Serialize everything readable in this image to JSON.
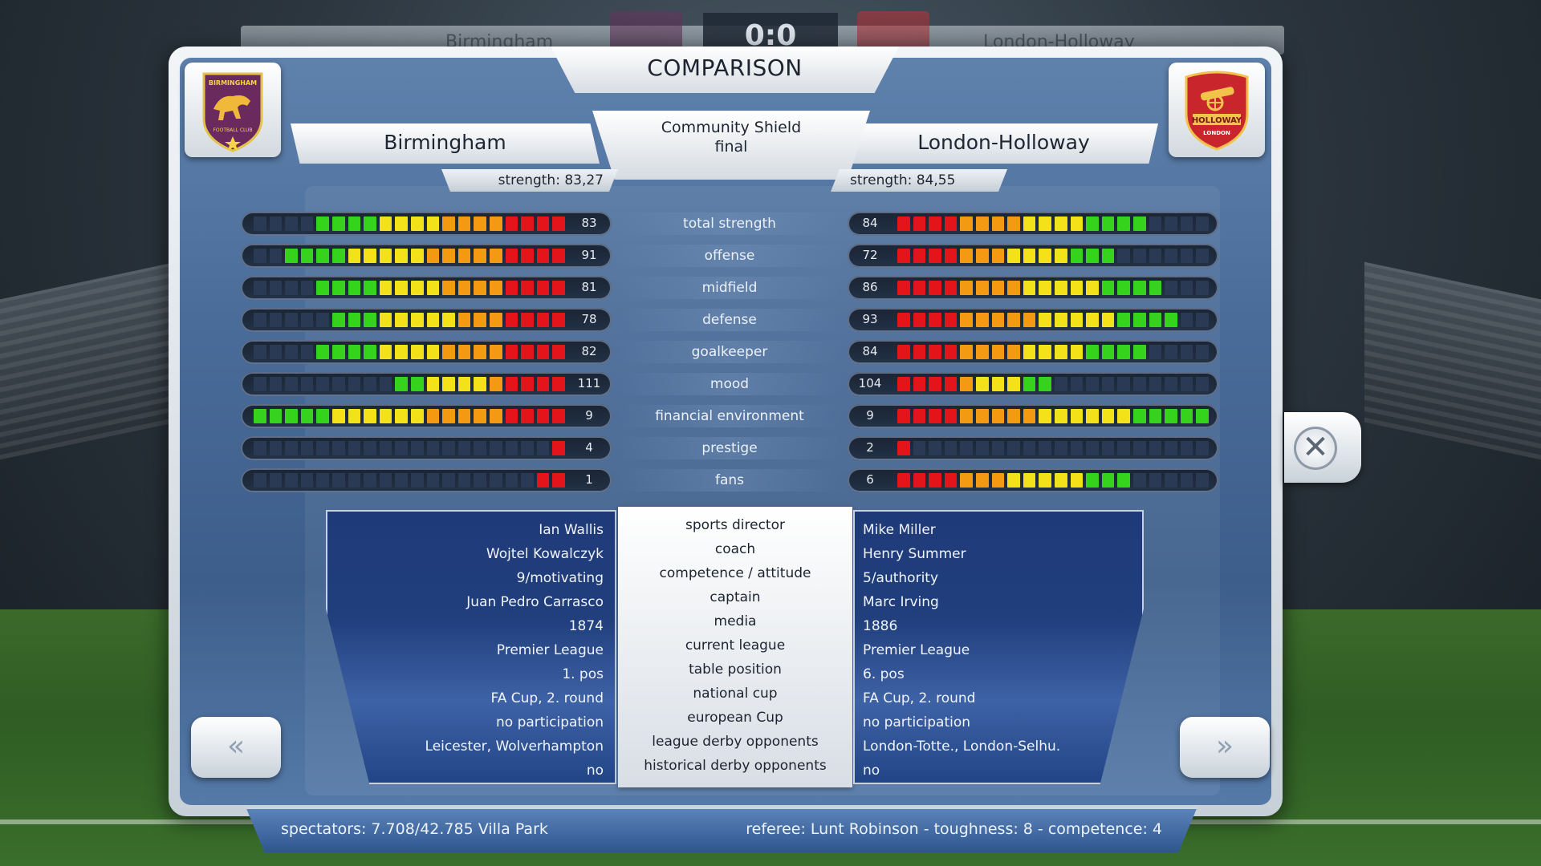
{
  "screen_title": "COMPARISON",
  "top_header": {
    "score": "0:0",
    "home_name": "Birmingham",
    "away_name": "London-Holloway"
  },
  "home_team": {
    "name": "Birmingham",
    "strength_text": "strength: 83,27",
    "crest_text_top": "BIRMINGHAM",
    "crest_text_bottom": "FOOTBALL CLUB",
    "crest_color": "#6b2a5e",
    "crest_icon": "dog-icon"
  },
  "away_team": {
    "name": "London-Holloway",
    "strength_text": "strength: 84,55",
    "crest_text_top": "HOLLOWAY",
    "crest_text_bottom": "LONDON",
    "crest_color": "#c8262c",
    "crest_icon": "cannon-icon"
  },
  "event": {
    "line1": "Community Shield",
    "line2": "final"
  },
  "stats": [
    {
      "label": "total strength",
      "home_value": "83",
      "away_value": "84",
      "home_fill": 16,
      "away_fill": 16
    },
    {
      "label": "offense",
      "home_value": "91",
      "away_value": "72",
      "home_fill": 18,
      "away_fill": 14
    },
    {
      "label": "midfield",
      "home_value": "81",
      "away_value": "86",
      "home_fill": 16,
      "away_fill": 17
    },
    {
      "label": "defense",
      "home_value": "78",
      "away_value": "93",
      "home_fill": 15,
      "away_fill": 18
    },
    {
      "label": "goalkeeper",
      "home_value": "82",
      "away_value": "84",
      "home_fill": 16,
      "away_fill": 16
    },
    {
      "label": "mood",
      "home_value": "111",
      "away_value": "104",
      "home_fill": 11,
      "away_fill": 10
    },
    {
      "label": "financial environment",
      "home_value": "9",
      "away_value": "9",
      "home_fill": 20,
      "away_fill": 20
    },
    {
      "label": "prestige",
      "home_value": "4",
      "away_value": "2",
      "home_fill": 1,
      "away_fill": 1
    },
    {
      "label": "fans",
      "home_value": "1",
      "away_value": "6",
      "home_fill": 2,
      "away_fill": 15
    }
  ],
  "bar_segments_total": 20,
  "bar_colors": {
    "red": "#e3151a",
    "orange": "#f39a12",
    "yellow": "#f3e21a",
    "green": "#35d31c",
    "empty": "#2a3a55"
  },
  "info_rows": [
    {
      "label": "sports director",
      "home": "Ian Wallis",
      "away": "Mike Miller"
    },
    {
      "label": "coach",
      "home": "Wojtel Kowalczyk",
      "away": "Henry Summer"
    },
    {
      "label": "competence / attitude",
      "home": "9/motivating",
      "away": "5/authority"
    },
    {
      "label": "captain",
      "home": "Juan Pedro Carrasco",
      "away": "Marc Irving"
    },
    {
      "label": "media",
      "home": "1874",
      "away": "1886"
    },
    {
      "label": "current league",
      "home": "Premier League",
      "away": "Premier League"
    },
    {
      "label": "table position",
      "home": "1. pos",
      "away": "6. pos"
    },
    {
      "label": "national cup",
      "home": "FA Cup, 2. round",
      "away": "FA Cup, 2. round"
    },
    {
      "label": "european Cup",
      "home": "no participation",
      "away": "no participation"
    },
    {
      "label": "league derby opponents",
      "home": "Leicester, Wolverhampton",
      "away": "London-Totte., London-Selhu."
    },
    {
      "label": "historical derby opponents",
      "home": "no",
      "away": "no"
    }
  ],
  "nav": {
    "prev_label": "«",
    "next_label": "»",
    "prev_icon": "double-chevron-left-icon",
    "next_icon": "double-chevron-right-icon"
  },
  "close": {
    "label": "✕",
    "icon": "close-icon"
  },
  "footer": {
    "spectators": "spectators: 7.708/42.785 Villa Park",
    "referee": "referee: Lunt Robinson - toughness: 8 - competence: 4"
  }
}
